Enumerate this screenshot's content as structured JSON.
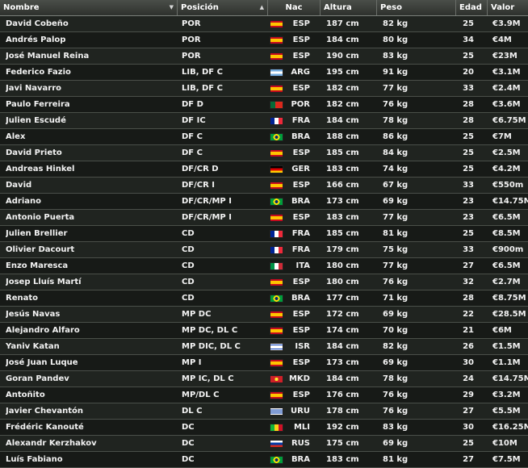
{
  "columns": {
    "name": "Nombre",
    "position": "Posición",
    "nationality": "Nac",
    "height": "Altura",
    "weight": "Peso",
    "age": "Edad",
    "value": "Valor"
  },
  "sort_icons": {
    "name": "chevron-down-icon",
    "position": "chevron-up-icon"
  },
  "flag_colors": {
    "ESP": "linear-gradient(#c60b1e 0 25%, #ffc400 25% 75%, #c60b1e 75%)",
    "ARG": "linear-gradient(#74acdf 0 33%, #ffffff 33% 66%, #74acdf 66%)",
    "POR": "linear-gradient(90deg, #046a38 0 40%, #da291c 40%)",
    "FRA": "linear-gradient(90deg, #002395 0 33%, #ffffff 33% 66%, #ed2939 66%)",
    "BRA": "radial-gradient(circle, #002776 0 22%, #fedf00 23% 45%, #009c3b 46%)",
    "GER": "linear-gradient(#000000 0 33%, #dd0000 33% 66%, #ffce00 66%)",
    "ITA": "linear-gradient(90deg, #009246 0 33%, #ffffff 33% 66%, #ce2b37 66%)",
    "ISR": "linear-gradient(#ffffff 0 15%, #0038b8 15% 25%, #ffffff 25% 75%, #0038b8 75% 85%, #ffffff 85%)",
    "MKD": "radial-gradient(circle, #f8e92e 0 25%, #ce2028 26%)",
    "URU": "linear-gradient(#ffffff 0 20%, #0038a8 20% 30%, #ffffff 30% 45%, #0038a8 45% 55%, #ffffff 55% 70%, #0038a8 70% 80%, #ffffff 80%)",
    "MLI": "linear-gradient(90deg, #14b53a 0 33%, #fcd116 33% 66%, #ce1126 66%)",
    "RUS": "linear-gradient(#ffffff 0 33%, #0039a6 33% 66%, #d52b1e 66%)"
  },
  "players": [
    {
      "name": "David Cobeño",
      "position": "POR",
      "nat": "ESP",
      "height": "187 cm",
      "weight": "82 kg",
      "age": "25",
      "value": "€3.9M"
    },
    {
      "name": "Andrés Palop",
      "position": "POR",
      "nat": "ESP",
      "height": "184 cm",
      "weight": "80 kg",
      "age": "34",
      "value": "€4M"
    },
    {
      "name": "José Manuel Reina",
      "position": "POR",
      "nat": "ESP",
      "height": "190 cm",
      "weight": "83 kg",
      "age": "25",
      "value": "€23M"
    },
    {
      "name": "Federico Fazio",
      "position": "LIB, DF C",
      "nat": "ARG",
      "height": "195 cm",
      "weight": "91 kg",
      "age": "20",
      "value": "€3.1M"
    },
    {
      "name": "Javi Navarro",
      "position": "LIB, DF C",
      "nat": "ESP",
      "height": "182 cm",
      "weight": "77 kg",
      "age": "33",
      "value": "€2.4M"
    },
    {
      "name": "Paulo Ferreira",
      "position": "DF D",
      "nat": "POR",
      "height": "182 cm",
      "weight": "76 kg",
      "age": "28",
      "value": "€3.6M"
    },
    {
      "name": "Julien Escudé",
      "position": "DF IC",
      "nat": "FRA",
      "height": "184 cm",
      "weight": "78 kg",
      "age": "28",
      "value": "€6.75M"
    },
    {
      "name": "Alex",
      "position": "DF C",
      "nat": "BRA",
      "height": "188 cm",
      "weight": "86 kg",
      "age": "25",
      "value": "€7M"
    },
    {
      "name": "David Prieto",
      "position": "DF C",
      "nat": "ESP",
      "height": "185 cm",
      "weight": "84 kg",
      "age": "25",
      "value": "€2.5M"
    },
    {
      "name": "Andreas Hinkel",
      "position": "DF/CR D",
      "nat": "GER",
      "height": "183 cm",
      "weight": "74 kg",
      "age": "25",
      "value": "€4.2M"
    },
    {
      "name": "David",
      "position": "DF/CR I",
      "nat": "ESP",
      "height": "166 cm",
      "weight": "67 kg",
      "age": "33",
      "value": "€550m"
    },
    {
      "name": "Adriano",
      "position": "DF/CR/MP I",
      "nat": "BRA",
      "height": "173 cm",
      "weight": "69 kg",
      "age": "23",
      "value": "€14.75M"
    },
    {
      "name": "Antonio Puerta",
      "position": "DF/CR/MP I",
      "nat": "ESP",
      "height": "183 cm",
      "weight": "77 kg",
      "age": "23",
      "value": "€6.5M"
    },
    {
      "name": "Julien Brellier",
      "position": "CD",
      "nat": "FRA",
      "height": "185 cm",
      "weight": "81 kg",
      "age": "25",
      "value": "€8.5M"
    },
    {
      "name": "Olivier Dacourt",
      "position": "CD",
      "nat": "FRA",
      "height": "179 cm",
      "weight": "75 kg",
      "age": "33",
      "value": "€900m"
    },
    {
      "name": "Enzo Maresca",
      "position": "CD",
      "nat": "ITA",
      "height": "180 cm",
      "weight": "77 kg",
      "age": "27",
      "value": "€6.5M"
    },
    {
      "name": "Josep Lluís Martí",
      "position": "CD",
      "nat": "ESP",
      "height": "180 cm",
      "weight": "76 kg",
      "age": "32",
      "value": "€2.7M"
    },
    {
      "name": "Renato",
      "position": "CD",
      "nat": "BRA",
      "height": "177 cm",
      "weight": "71 kg",
      "age": "28",
      "value": "€8.75M"
    },
    {
      "name": "Jesús Navas",
      "position": "MP DC",
      "nat": "ESP",
      "height": "172 cm",
      "weight": "69 kg",
      "age": "22",
      "value": "€28.5M"
    },
    {
      "name": "Alejandro Alfaro",
      "position": "MP DC, DL C",
      "nat": "ESP",
      "height": "174 cm",
      "weight": "70 kg",
      "age": "21",
      "value": "€6M"
    },
    {
      "name": "Yaniv Katan",
      "position": "MP DIC, DL C",
      "nat": "ISR",
      "height": "184 cm",
      "weight": "82 kg",
      "age": "26",
      "value": "€1.5M"
    },
    {
      "name": "José Juan Luque",
      "position": "MP I",
      "nat": "ESP",
      "height": "173 cm",
      "weight": "69 kg",
      "age": "30",
      "value": "€1.1M"
    },
    {
      "name": "Goran Pandev",
      "position": "MP IC, DL C",
      "nat": "MKD",
      "height": "184 cm",
      "weight": "78 kg",
      "age": "24",
      "value": "€14.75M"
    },
    {
      "name": "Antoñito",
      "position": "MP/DL C",
      "nat": "ESP",
      "height": "176 cm",
      "weight": "76 kg",
      "age": "29",
      "value": "€3.2M"
    },
    {
      "name": "Javier Chevantón",
      "position": "DL C",
      "nat": "URU",
      "height": "178 cm",
      "weight": "76 kg",
      "age": "27",
      "value": "€5.5M"
    },
    {
      "name": "Frédéric Kanouté",
      "position": "DC",
      "nat": "MLI",
      "height": "192 cm",
      "weight": "83 kg",
      "age": "30",
      "value": "€16.25M"
    },
    {
      "name": "Alexandr Kerzhakov",
      "position": "DC",
      "nat": "RUS",
      "height": "175 cm",
      "weight": "69 kg",
      "age": "25",
      "value": "€10M"
    },
    {
      "name": "Luís Fabiano",
      "position": "DC",
      "nat": "BRA",
      "height": "183 cm",
      "weight": "81 kg",
      "age": "27",
      "value": "€7.5M"
    }
  ]
}
